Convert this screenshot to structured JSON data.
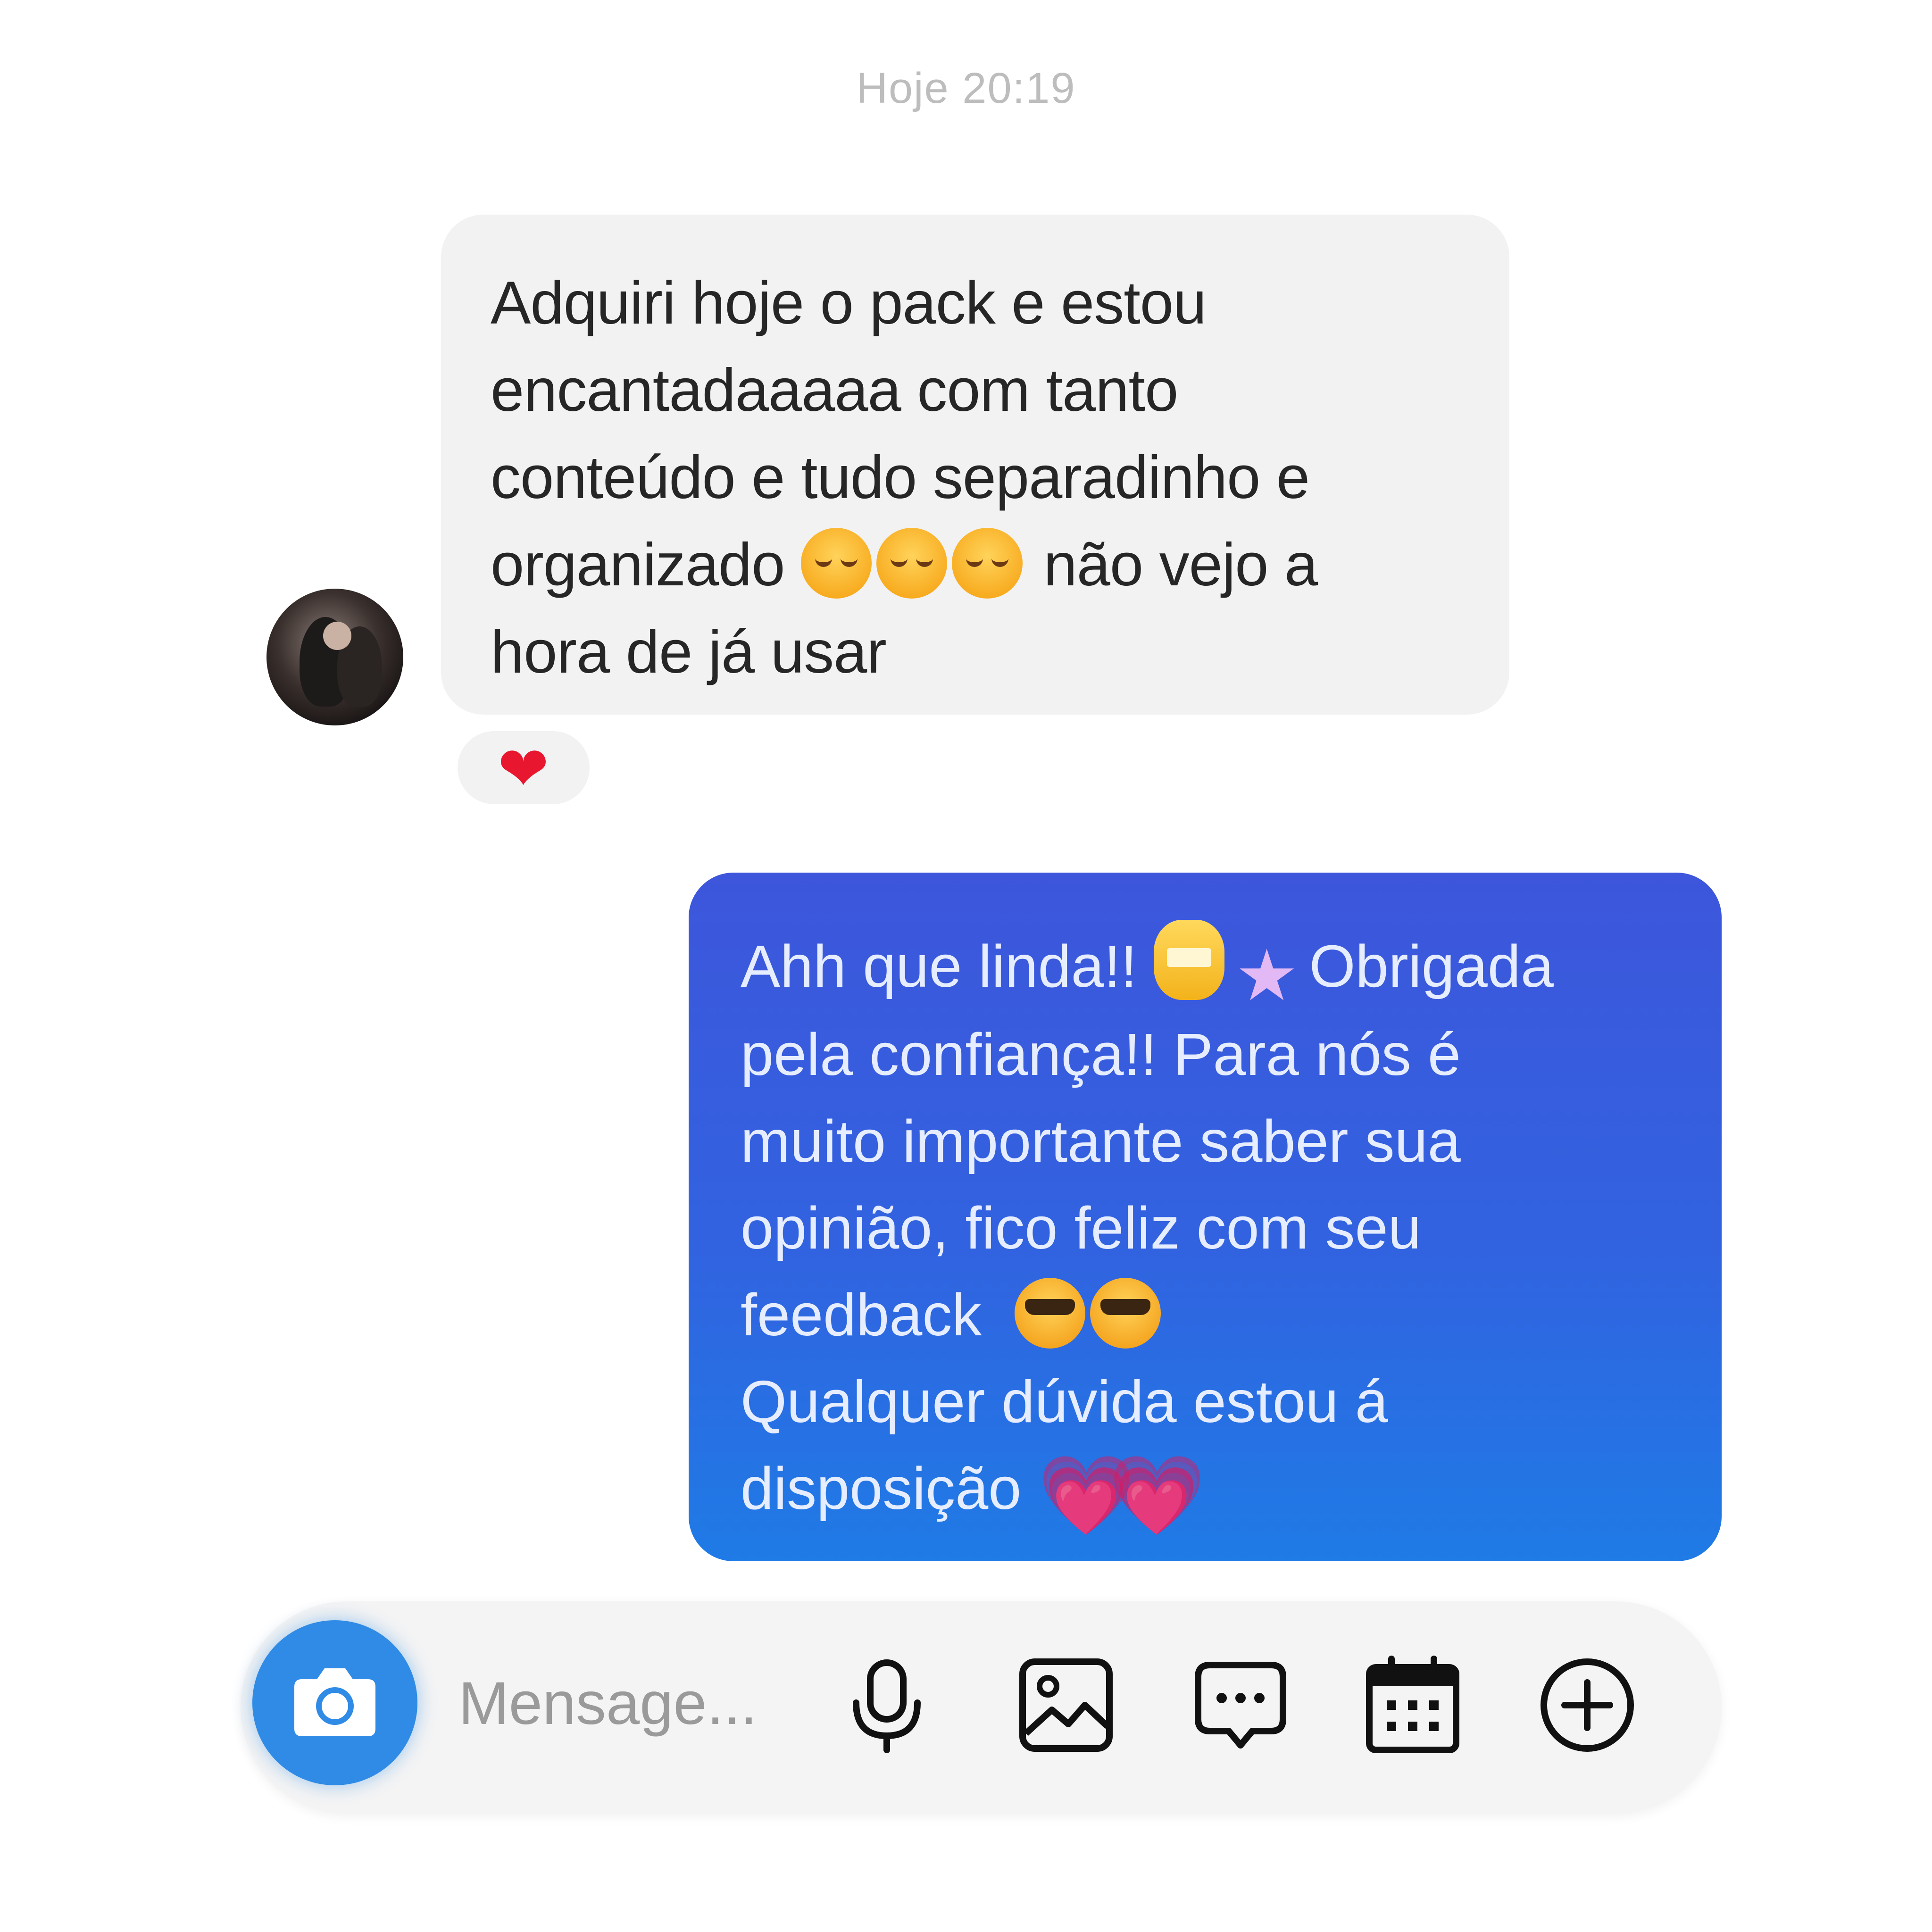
{
  "thread": {
    "timestamp": "Hoje 20:19"
  },
  "incoming": {
    "lines": [
      "Adquiri hoje o pack e estou",
      "encantadaaaaa com tanto",
      "conteúdo e tudo separadinho e",
      "organizado",
      "não vejo a",
      "hora de já usar"
    ],
    "reaction": "❤"
  },
  "outgoing": {
    "line1_a": "Ahh que linda!!",
    "line1_b": "Obrigada",
    "line2": "pela confiança!! Para nós é",
    "line3": "muito importante saber sua",
    "line4": "opinião, fico feliz com seu",
    "line5": "feedback",
    "line6": "Qualquer dúvida estou á",
    "line7": "disposição",
    "heart_a": "💗",
    "heart_b": "💗",
    "star": "★"
  },
  "composer": {
    "placeholder": "Mensage..."
  },
  "icons": {
    "camera": "camera-icon",
    "mic": "microphone-icon",
    "gallery": "image-icon",
    "chat": "chat-bubble-icon",
    "calendar": "calendar-icon",
    "plus": "plus-circle-icon"
  },
  "colors": {
    "outgoing_top": "#3d56db",
    "outgoing_bottom": "#1f7be6",
    "incoming_bg": "#f2f2f2",
    "camera_button": "#2f8be5",
    "heart": "#e8162f"
  }
}
